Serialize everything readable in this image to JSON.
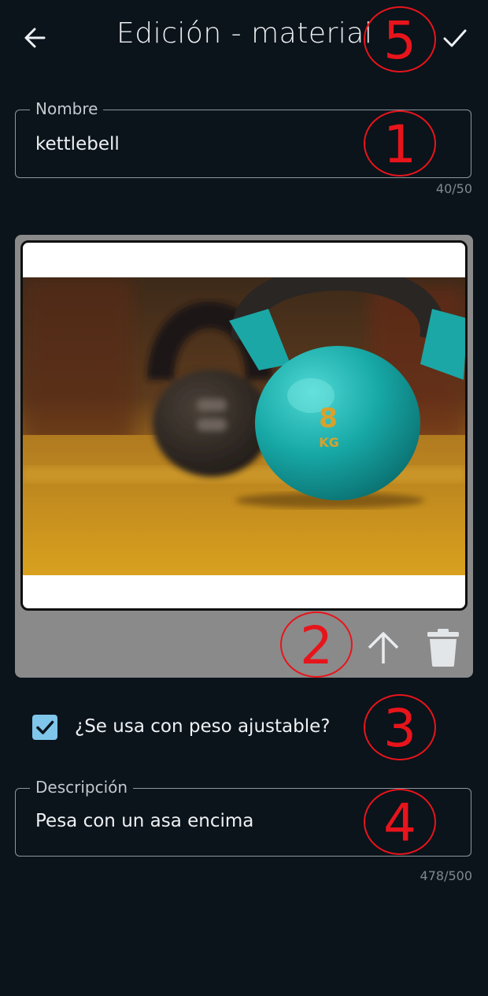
{
  "header": {
    "title": "Edición - material",
    "back_icon": "arrow-left-icon",
    "confirm_icon": "check-icon"
  },
  "name_field": {
    "label": "Nombre",
    "value": "kettlebell",
    "counter": "40/50"
  },
  "image_section": {
    "photo_icon": "kettlebell-photo",
    "upload_icon": "arrow-up-icon",
    "delete_icon": "trash-icon"
  },
  "adjustable": {
    "checked": true,
    "label": "¿Se usa con peso ajustable?"
  },
  "description_field": {
    "label": "Descripción",
    "value": "Pesa con un asa encima",
    "counter": "478/500"
  },
  "annotations": [
    "5",
    "1",
    "2",
    "3",
    "4"
  ],
  "colors": {
    "background": "#0b131b",
    "accent": "#7fc6ea",
    "annotation": "#e8141b",
    "card": "#8a8a8a"
  }
}
